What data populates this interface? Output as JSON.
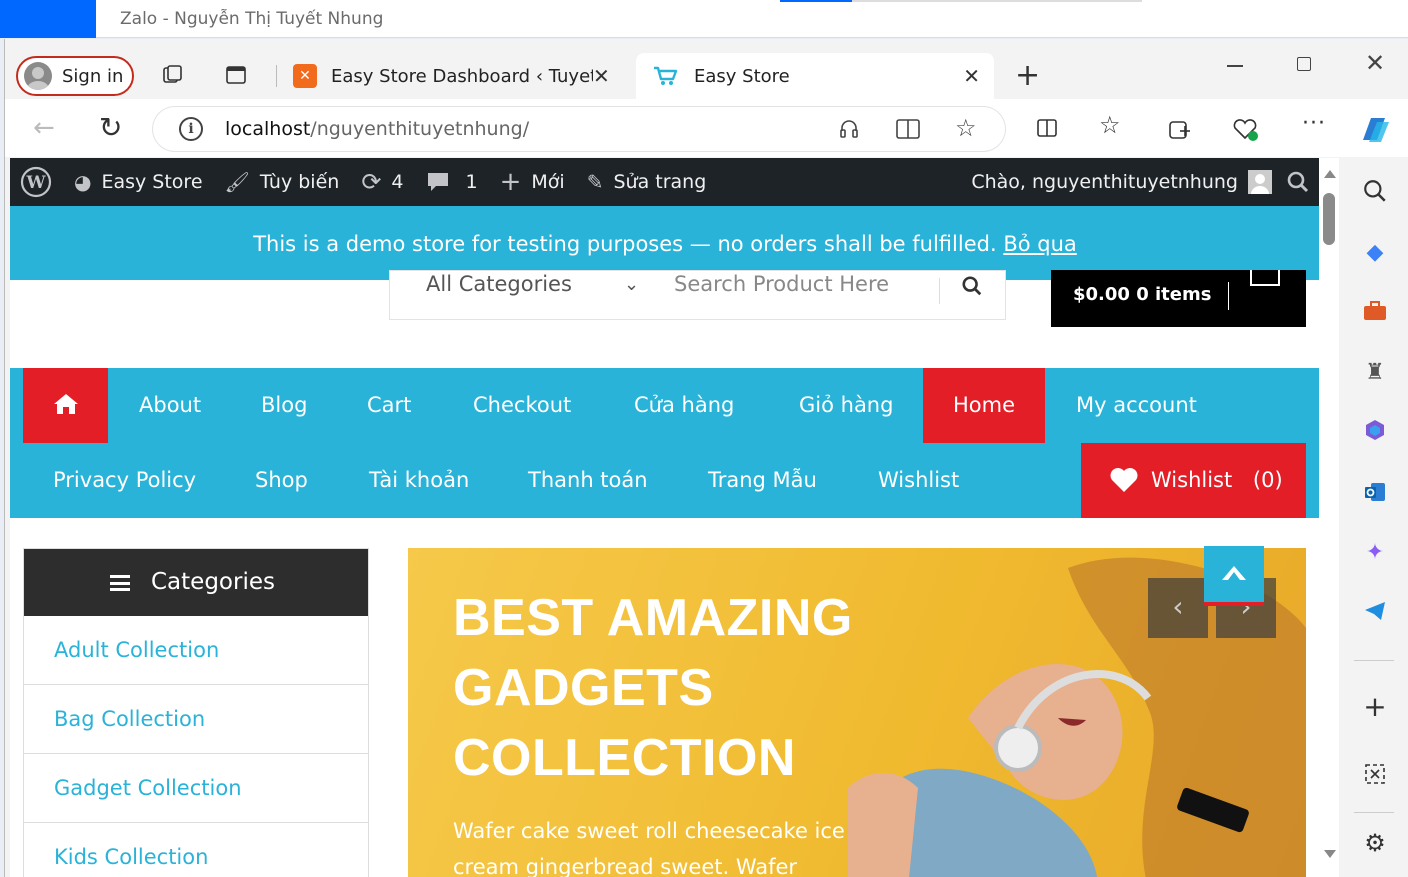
{
  "zalo": {
    "title": "Zalo - Nguyễn Thị Tuyết Nhung"
  },
  "browser": {
    "signin_label": "Sign in",
    "tabs": [
      {
        "title": "Easy Store Dashboard ‹ Tuyetnhung"
      },
      {
        "title": "Easy Store"
      }
    ],
    "url_host": "localhost",
    "url_path": "/nguyenthituyetnhung/"
  },
  "wpbar": {
    "site": "Easy Store",
    "customize": "Tùy biến",
    "updates": "4",
    "comments": "1",
    "new": "Mới",
    "edit": "Sửa trang",
    "greeting": "Chào, nguyenthituyetnhung"
  },
  "notice": {
    "text": "This is a demo store for testing purposes — no orders shall be fulfilled.",
    "dismiss": "Bỏ qua"
  },
  "search": {
    "category": "All Categories",
    "placeholder": "Search Product Here"
  },
  "cart": {
    "label": "$0.00 0 items"
  },
  "nav": {
    "row1": [
      "About",
      "Blog",
      "Cart",
      "Checkout",
      "Cửa hàng",
      "Giỏ hàng",
      "Home",
      "My account"
    ],
    "row2": [
      "Privacy Policy",
      "Shop",
      "Tài khoản",
      "Thanh toán",
      "Trang Mẫu",
      "Wishlist"
    ],
    "wishlist_label": "Wishlist",
    "wishlist_count": "(0)"
  },
  "categories": {
    "title": "Categories",
    "items": [
      "Adult Collection",
      "Bag Collection",
      "Gadget Collection",
      "Kids Collection"
    ]
  },
  "hero": {
    "title": "BEST AMAZING GADGETS COLLECTION",
    "text": "Wafer cake sweet roll cheesecake ice cream gingerbread sweet. Wafer"
  },
  "colors": {
    "accent": "#2ab3d8",
    "red": "#e31e27",
    "dark": "#1d2327",
    "banner": "#f0ba2f"
  }
}
